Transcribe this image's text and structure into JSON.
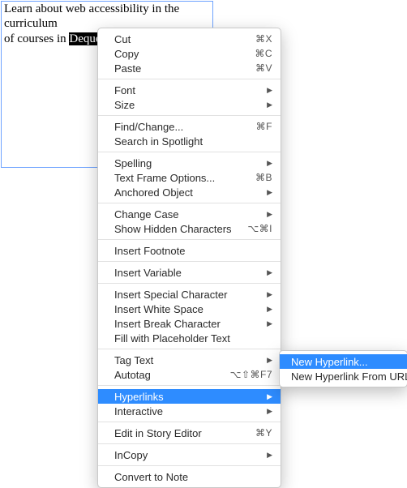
{
  "text_frame": {
    "line1": "Learn about web accessibility in the curriculum ",
    "line2_prefix": "of courses in ",
    "line2_highlighted": "Deque University."
  },
  "menu": [
    {
      "type": "item",
      "label": "Cut",
      "shortcut": "⌘X"
    },
    {
      "type": "item",
      "label": "Copy",
      "shortcut": "⌘C"
    },
    {
      "type": "item",
      "label": "Paste",
      "shortcut": "⌘V"
    },
    {
      "type": "sep"
    },
    {
      "type": "item",
      "label": "Font",
      "submenu": true
    },
    {
      "type": "item",
      "label": "Size",
      "submenu": true
    },
    {
      "type": "sep"
    },
    {
      "type": "item",
      "label": "Find/Change...",
      "shortcut": "⌘F"
    },
    {
      "type": "item",
      "label": "Search in Spotlight"
    },
    {
      "type": "sep"
    },
    {
      "type": "item",
      "label": "Spelling",
      "submenu": true
    },
    {
      "type": "item",
      "label": "Text Frame Options...",
      "shortcut": "⌘B"
    },
    {
      "type": "item",
      "label": "Anchored Object",
      "submenu": true
    },
    {
      "type": "sep"
    },
    {
      "type": "item",
      "label": "Change Case",
      "submenu": true
    },
    {
      "type": "item",
      "label": "Show Hidden Characters",
      "shortcut": "⌥⌘I"
    },
    {
      "type": "sep"
    },
    {
      "type": "item",
      "label": "Insert Footnote"
    },
    {
      "type": "sep"
    },
    {
      "type": "item",
      "label": "Insert Variable",
      "submenu": true
    },
    {
      "type": "sep"
    },
    {
      "type": "item",
      "label": "Insert Special Character",
      "submenu": true
    },
    {
      "type": "item",
      "label": "Insert White Space",
      "submenu": true
    },
    {
      "type": "item",
      "label": "Insert Break Character",
      "submenu": true
    },
    {
      "type": "item",
      "label": "Fill with Placeholder Text"
    },
    {
      "type": "sep"
    },
    {
      "type": "item",
      "label": "Tag Text",
      "submenu": true
    },
    {
      "type": "item",
      "label": "Autotag",
      "shortcut": "⌥⇧⌘F7"
    },
    {
      "type": "sep"
    },
    {
      "type": "item",
      "label": "Hyperlinks",
      "submenu": true,
      "selected": true
    },
    {
      "type": "item",
      "label": "Interactive",
      "submenu": true
    },
    {
      "type": "sep"
    },
    {
      "type": "item",
      "label": "Edit in Story Editor",
      "shortcut": "⌘Y"
    },
    {
      "type": "sep"
    },
    {
      "type": "item",
      "label": "InCopy",
      "submenu": true
    },
    {
      "type": "sep"
    },
    {
      "type": "item",
      "label": "Convert to Note"
    }
  ],
  "submenu": [
    {
      "label": "New Hyperlink...",
      "selected": true
    },
    {
      "label": "New Hyperlink From URL"
    }
  ]
}
